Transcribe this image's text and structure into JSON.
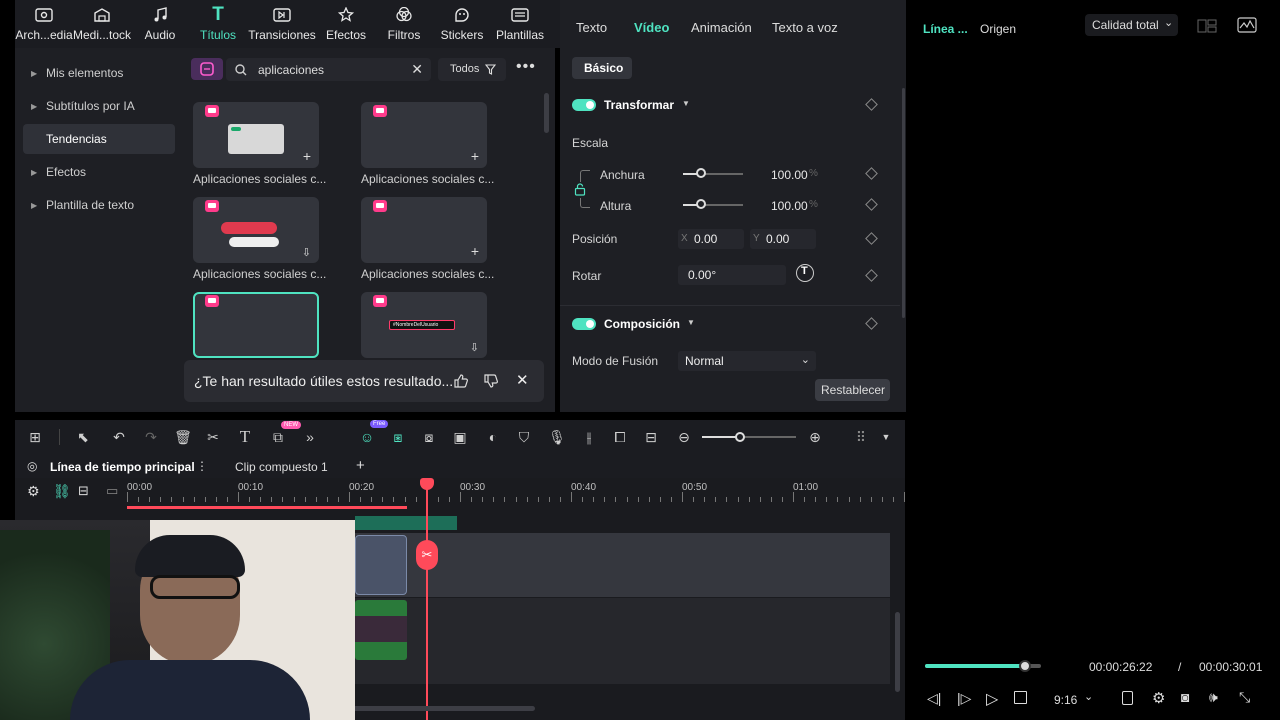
{
  "asset_tabs": [
    {
      "label": "Arch...edia",
      "icon": "folder-icon"
    },
    {
      "label": "Medi...tock",
      "icon": "stock-icon"
    },
    {
      "label": "Audio",
      "icon": "music-note-icon"
    },
    {
      "label": "Títulos",
      "icon": "title-t-icon",
      "active": true
    },
    {
      "label": "Transiciones",
      "icon": "transition-icon"
    },
    {
      "label": "Efectos",
      "icon": "effects-icon"
    },
    {
      "label": "Filtros",
      "icon": "filter-icon"
    },
    {
      "label": "Stickers",
      "icon": "sticker-icon"
    },
    {
      "label": "Plantillas",
      "icon": "template-icon"
    }
  ],
  "sidebar": {
    "items": [
      {
        "label": "Mis elementos"
      },
      {
        "label": "Subtítulos por IA"
      },
      {
        "label": "Tendencias",
        "active": true
      },
      {
        "label": "Efectos"
      },
      {
        "label": "Plantilla de texto"
      }
    ]
  },
  "search": {
    "value": "aplicaciones",
    "filter_label": "Todos"
  },
  "titles_grid": {
    "items": [
      {
        "label": "Aplicaciones sociales c..."
      },
      {
        "label": "Aplicaciones sociales c..."
      },
      {
        "label": "Aplicaciones sociales c..."
      },
      {
        "label": "Aplicaciones sociales c..."
      }
    ],
    "thumb5_text": "#NombreDelUsuario"
  },
  "feedback": {
    "text": "¿Te han resultado útiles estos resultado..."
  },
  "props": {
    "tabs": [
      "Texto",
      "Vídeo",
      "Animación",
      "Texto a voz"
    ],
    "active_tab": "Vídeo",
    "subtab": "Básico",
    "transform": {
      "title": "Transformar",
      "scale_label": "Escala",
      "width_label": "Anchura",
      "width_value": "100.00",
      "height_label": "Altura",
      "height_value": "100.00",
      "percent": "%",
      "position_label": "Posición",
      "x_label": "X",
      "x_value": "0.00",
      "y_label": "Y",
      "y_value": "0.00",
      "rotate_label": "Rotar",
      "rotate_value": "0.00°"
    },
    "composition": {
      "title": "Composición",
      "blend_label": "Modo de Fusión",
      "blend_value": "Normal"
    },
    "reset_label": "Restablecer"
  },
  "preview": {
    "tab_timeline": "Línea ...",
    "tab_origin": "Origen",
    "quality": "Calidad total",
    "current_time": "00:00:26:22",
    "separator": "/",
    "total_time": "00:00:30:01",
    "ratio": "9:16",
    "progress_fraction": 0.86
  },
  "toolbar": {
    "badge_new": "NEW",
    "badge_free": "Free"
  },
  "timeline": {
    "main_tab": "Línea de tiempo principal",
    "compound_tab": "Clip compuesto 1",
    "ticks": [
      "00:00",
      "00:10",
      "00:20",
      "00:30",
      "00:40",
      "00:50",
      "01:00"
    ]
  }
}
